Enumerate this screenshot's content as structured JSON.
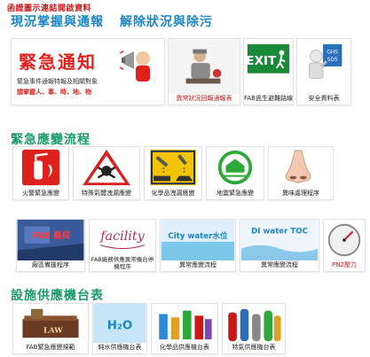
{
  "header": {
    "note": "函證圖示連結開啟資料",
    "link_left": "現況掌握與通報",
    "link_right": "解除狀況與除污"
  },
  "row1": {
    "banner": {
      "title": "緊急通知",
      "line1": "緊急事件通報特報及相關對象",
      "line2": "請掌握人、事、時、地、物"
    },
    "tiles": [
      {
        "label": "異常狀況回報通報表",
        "icon": "injured-worker-icon"
      },
      {
        "label": "FAB逃生避難路線",
        "icon": "exit-sign-icon",
        "exit_text": "EXIT"
      },
      {
        "label": "安全資料表",
        "icon": "sds-document-icon",
        "sds_text": "GHS SDS"
      }
    ]
  },
  "section2": {
    "title": "緊急應變流程",
    "tiles": [
      {
        "label": "火警緊急應變",
        "icon": "fire-extinguisher-icon"
      },
      {
        "label": "特殊氣體洩漏應變",
        "icon": "toxic-hazard-icon"
      },
      {
        "label": "化學品洩漏應變",
        "icon": "corrosive-hazard-icon"
      },
      {
        "label": "地震緊急應變",
        "icon": "earthquake-icon"
      },
      {
        "label": "異味處理程序",
        "icon": "nose-icon"
      }
    ]
  },
  "section3": {
    "tiles": [
      {
        "label": "廠區備援程序",
        "icon": "fab-building-icon",
        "art_text": "FAB 廠房"
      },
      {
        "label": "FAB廠務供應異常機台停機程序",
        "icon": "facility-logo-icon",
        "art_text": "facility"
      },
      {
        "label": "異常應變流程",
        "icon": "city-water-icon",
        "art_text": "City water水位"
      },
      {
        "label": "異常應變流程",
        "icon": "di-water-icon",
        "art_text": "DI water TOC"
      },
      {
        "label": "PN2壓力",
        "icon": "pressure-gauge-icon"
      }
    ]
  },
  "section4": {
    "title": "設施供應機台表",
    "tiles": [
      {
        "label": "FAB緊急應變規範",
        "icon": "law-book-icon",
        "art_text": "LAW"
      },
      {
        "label": "純水供應機台表",
        "icon": "h2o-water-icon",
        "art_text": "H₂O"
      },
      {
        "label": "化學品供應機台表",
        "icon": "chemical-bottles-icon"
      },
      {
        "label": "特氣供應機台表",
        "icon": "gas-cylinders-icon"
      }
    ]
  }
}
